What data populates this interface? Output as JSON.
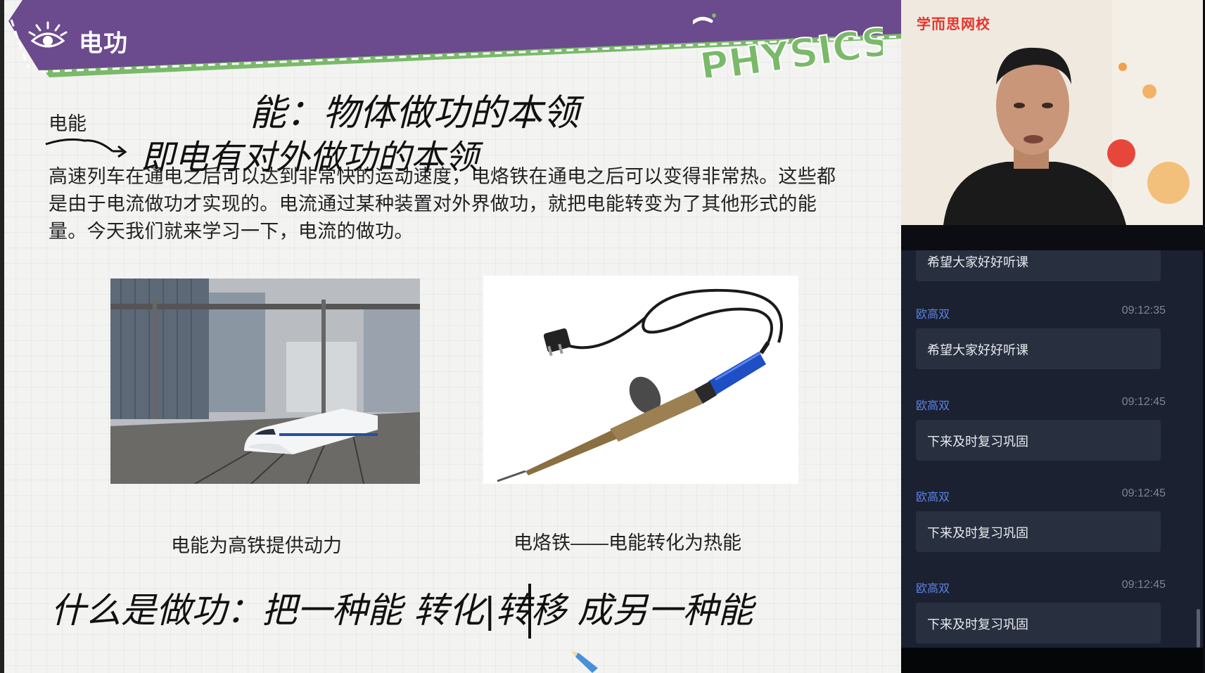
{
  "slide": {
    "title": "电功",
    "logo_text": "PHYSICS",
    "section_label": "电能",
    "paragraph": "高速列车在通电之后可以达到非常快的运动速度，电烙铁在通电之后可以变得非常热。这些都是由于电流做功才实现的。电流通过某种装置对外界做功，就把电能转变为了其他形式的能量。今天我们就来学习一下，电流的做功。",
    "caption_left": "电能为高铁提供动力",
    "caption_right": "电烙铁——电能转化为热能",
    "handwriting": {
      "line1": "能：物体做功的本领",
      "line2": "即电有对外做功的本领",
      "line3": "什么是做功：把一种能 转化|转移 成另一种能"
    }
  },
  "sidebar": {
    "brand": "学而思网校",
    "first_message": "希望大家好好听课",
    "messages": [
      {
        "name": "欧高双",
        "time": "09:12:35",
        "text": "希望大家好好听课"
      },
      {
        "name": "欧高双",
        "time": "09:12:45",
        "text": "下来及时复习巩固"
      },
      {
        "name": "欧高双",
        "time": "09:12:45",
        "text": "下来及时复习巩固"
      },
      {
        "name": "欧高双",
        "time": "09:12:45",
        "text": "下来及时复习巩固"
      }
    ]
  },
  "colors": {
    "banner_purple": "#6b4a8d",
    "banner_trim": "#7ab96a",
    "chat_name": "#5b83e6",
    "brand_red": "#e7332a"
  }
}
